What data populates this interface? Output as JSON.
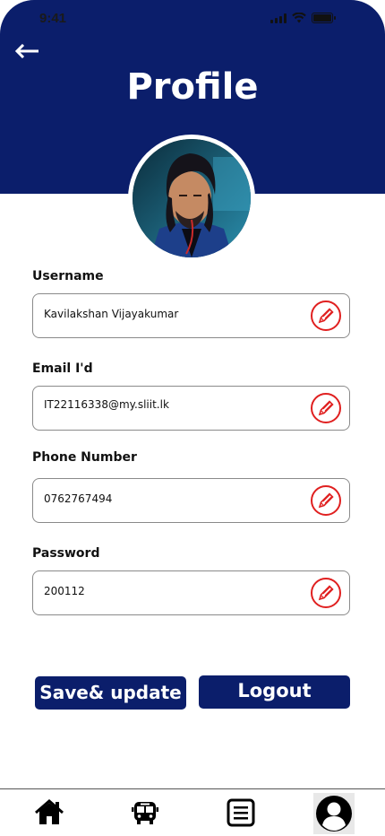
{
  "status_bar": {
    "time": "9:41"
  },
  "header": {
    "title": "Profile",
    "back_icon": "arrow-left-icon"
  },
  "avatar": {
    "icon": "profile-photo"
  },
  "fields": [
    {
      "label": "Username",
      "value": "Kavilakshan Vijayakumar",
      "icon": "pencil-icon"
    },
    {
      "label": "Email I'd",
      "value": "IT22116338@my.sliit.lk",
      "icon": "pencil-icon"
    },
    {
      "label": "Phone Number",
      "value": "0762767494",
      "icon": "pencil-icon"
    },
    {
      "label": "Password",
      "value": "200112",
      "icon": "pencil-icon"
    }
  ],
  "actions": {
    "save_label": "Save& update",
    "logout_label": "Logout"
  },
  "bottom_nav": {
    "items": [
      {
        "icon": "home-icon"
      },
      {
        "icon": "bus-icon"
      },
      {
        "icon": "list-icon"
      },
      {
        "icon": "user-icon",
        "active": true
      }
    ]
  },
  "colors": {
    "primary": "#0b1e6b",
    "edit_accent": "#e02020"
  }
}
